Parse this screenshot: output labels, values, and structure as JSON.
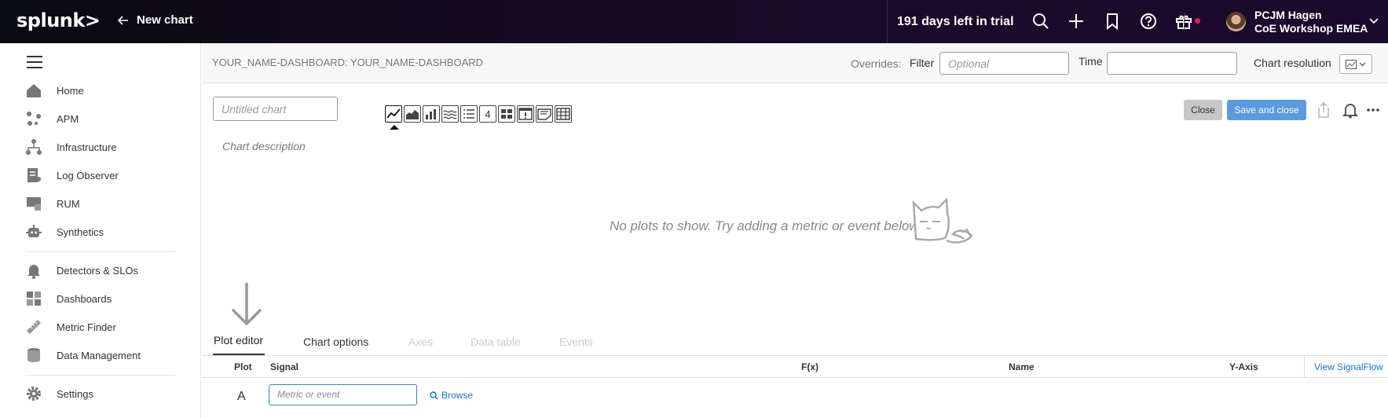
{
  "topbar": {
    "logo": "splunk>",
    "back_label": "New chart",
    "trial": "191 days left in trial",
    "icons": [
      "search-icon",
      "plus-icon",
      "bookmark-icon",
      "help-icon",
      "gift-icon"
    ],
    "user_name": "PCJM Hagen",
    "user_org": "CoE Workshop EMEA"
  },
  "sidebar": {
    "items": [
      {
        "label": "Home",
        "icon": "home-icon"
      },
      {
        "label": "APM",
        "icon": "apm-icon"
      },
      {
        "label": "Infrastructure",
        "icon": "infrastructure-icon"
      },
      {
        "label": "Log Observer",
        "icon": "log-icon"
      },
      {
        "label": "RUM",
        "icon": "rum-icon"
      },
      {
        "label": "Synthetics",
        "icon": "synthetics-icon"
      },
      {
        "label": "Detectors & SLOs",
        "icon": "bell-icon"
      },
      {
        "label": "Dashboards",
        "icon": "dashboard-icon"
      },
      {
        "label": "Metric Finder",
        "icon": "ruler-icon"
      },
      {
        "label": "Data Management",
        "icon": "database-icon"
      },
      {
        "label": "Settings",
        "icon": "gear-icon"
      }
    ]
  },
  "subheader": {
    "dashboard": "YOUR_NAME-DASHBOARD: YOUR_NAME-DASHBOARD",
    "overrides": "Overrides:",
    "filter_label": "Filter",
    "filter_placeholder": "Optional",
    "time_label": "Time",
    "time_value": "",
    "resolution_label": "Chart resolution"
  },
  "chart": {
    "title_placeholder": "Untitled chart",
    "description": "Chart description",
    "types": [
      "line",
      "area",
      "column",
      "histogram",
      "list",
      "4",
      "heatmap",
      "event-feed",
      "text",
      "table"
    ],
    "selected_type": "line",
    "close_label": "Close",
    "save_label": "Save and close",
    "empty_message": "No plots to show. Try adding a metric or event below."
  },
  "tabs": [
    "Plot editor",
    "Chart options",
    "Axes",
    "Data table",
    "Events"
  ],
  "table": {
    "headers": {
      "plot": "Plot",
      "signal": "Signal",
      "fx": "F(x)",
      "name": "Name",
      "yaxis": "Y-Axis"
    },
    "view_signalflow": "View SignalFlow",
    "row_letter": "A",
    "metric_placeholder": "Metric or event",
    "browse_label": "Browse"
  },
  "colors": {
    "accent": "#5a9be0",
    "link": "#1a73c8",
    "topbar": "#1a0a2a",
    "notify_dot": "#e0234e"
  }
}
